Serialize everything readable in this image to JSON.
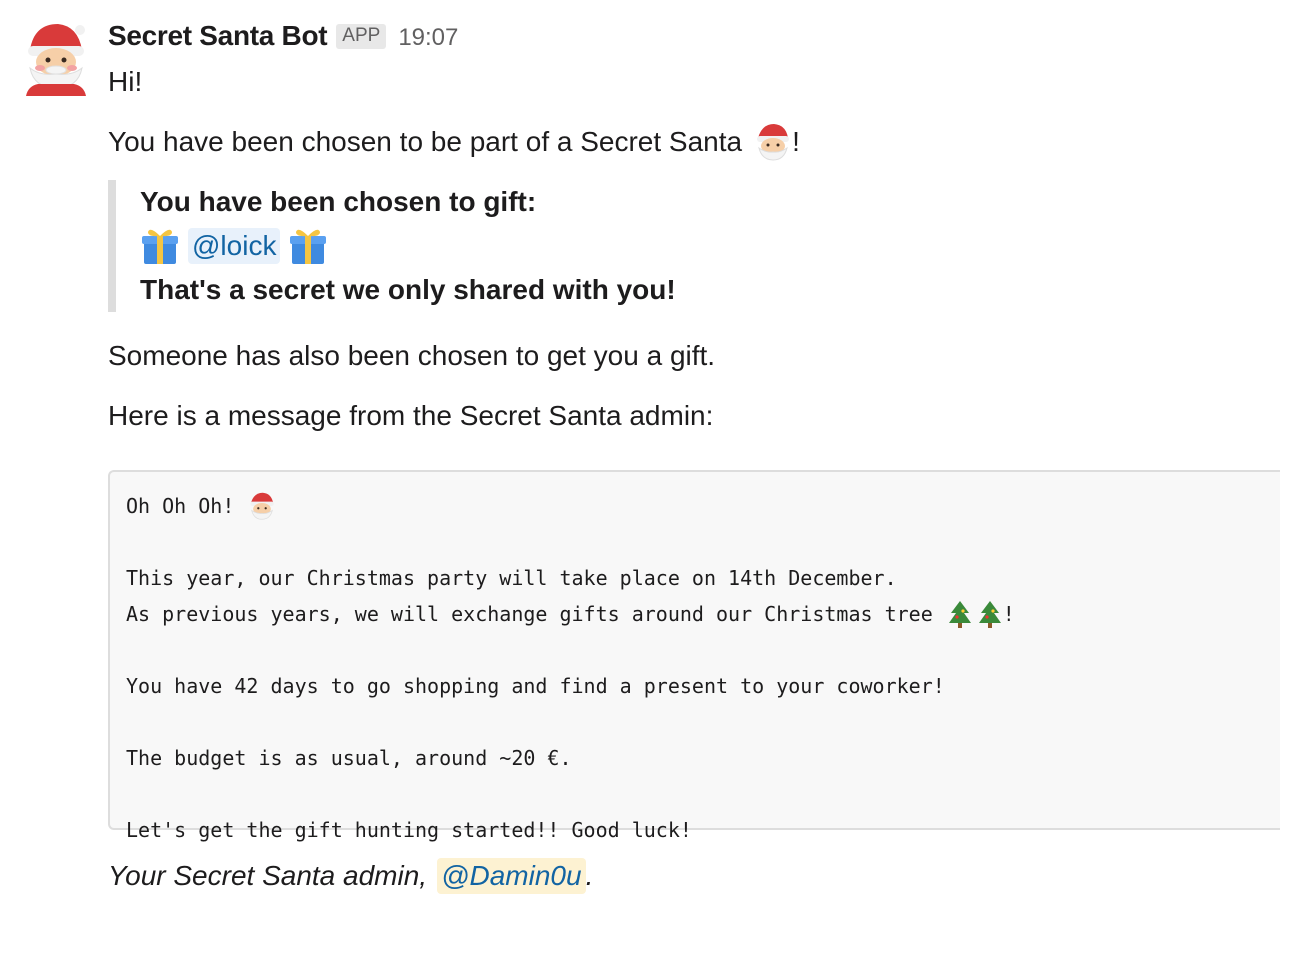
{
  "sender": {
    "name": "Secret Santa Bot",
    "badge": "APP",
    "time": "19:07"
  },
  "message": {
    "greeting": "Hi!",
    "chosen_text": "You have been chosen to be part of a Secret Santa",
    "chosen_suffix": "!",
    "quote": {
      "title": "You have been chosen to gift:",
      "mention": "@loick",
      "footer": "That's a secret we only shared with you!"
    },
    "someone_text": "Someone has also been chosen to get you a gift.",
    "admin_intro": "Here is a message from the Secret Santa admin:",
    "code": {
      "line1": "Oh Oh Oh!",
      "line2": "This year, our Christmas party will take place on 14th December.",
      "line3": "As previous years, we will exchange gifts around our Christmas tree",
      "line3_suffix": "!",
      "line4": "You have 42 days to go shopping and find a present to your coworker!",
      "line5": "The budget is as usual, around ~20 €.",
      "line6": "Let's get the gift hunting started!! Good luck!"
    },
    "signature_text": "Your Secret Santa admin,",
    "signature_mention": "@Damin0u",
    "signature_suffix": "."
  },
  "icons": {
    "avatar": "santa-avatar-icon",
    "santa": "santa-emoji-icon",
    "gift": "gift-emoji-icon",
    "tree": "christmas-tree-emoji-icon"
  },
  "colors": {
    "mention_text": "#1264a3",
    "mention_bg": "#e8f1fb",
    "highlight_mention_bg": "#fdf2d2",
    "quote_border": "#dddddd",
    "code_bg": "#f8f8f8"
  }
}
